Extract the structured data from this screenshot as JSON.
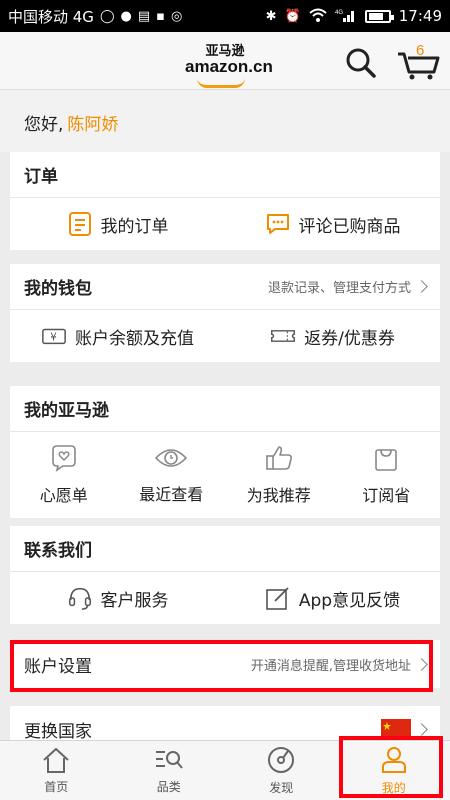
{
  "status_bar": {
    "carrier": "中国移动 4G",
    "network": "4G",
    "time": "17:49"
  },
  "header": {
    "logo_cn": "亚马逊",
    "logo_en": "amazon.cn",
    "cart_count": "6"
  },
  "greeting": {
    "hello": "您好,",
    "name": "陈阿娇"
  },
  "orders": {
    "title": "订单",
    "items": [
      {
        "label": "我的订单",
        "icon": "order-list-icon"
      },
      {
        "label": "评论已购商品",
        "icon": "comment-icon"
      }
    ]
  },
  "wallet": {
    "title": "我的钱包",
    "meta": "退款记录、管理支付方式",
    "items": [
      {
        "label": "账户余额及充值",
        "icon": "yen-card-icon"
      },
      {
        "label": "返券/优惠券",
        "icon": "coupon-icon"
      }
    ]
  },
  "my_amazon": {
    "title": "我的亚马逊",
    "items": [
      {
        "label": "心愿单",
        "icon": "wish-icon"
      },
      {
        "label": "最近查看",
        "icon": "eye-icon"
      },
      {
        "label": "为我推荐",
        "icon": "thumbs-up-icon"
      },
      {
        "label": "订阅省",
        "icon": "bag-icon"
      }
    ]
  },
  "contact": {
    "title": "联系我们",
    "items": [
      {
        "label": "客户服务",
        "icon": "headset-icon"
      },
      {
        "label": "App意见反馈",
        "icon": "feedback-icon"
      }
    ]
  },
  "account_settings": {
    "title": "账户设置",
    "meta": "开通消息提醒,管理收货地址"
  },
  "change_country": {
    "title": "更换国家"
  },
  "tabbar": {
    "items": [
      {
        "label": "首页",
        "icon": "home-icon"
      },
      {
        "label": "品类",
        "icon": "category-search-icon"
      },
      {
        "label": "发现",
        "icon": "discover-icon"
      },
      {
        "label": "我的",
        "icon": "user-icon",
        "active": true
      }
    ]
  },
  "colors": {
    "accent": "#f08c00",
    "highlight": "#ff0010"
  }
}
